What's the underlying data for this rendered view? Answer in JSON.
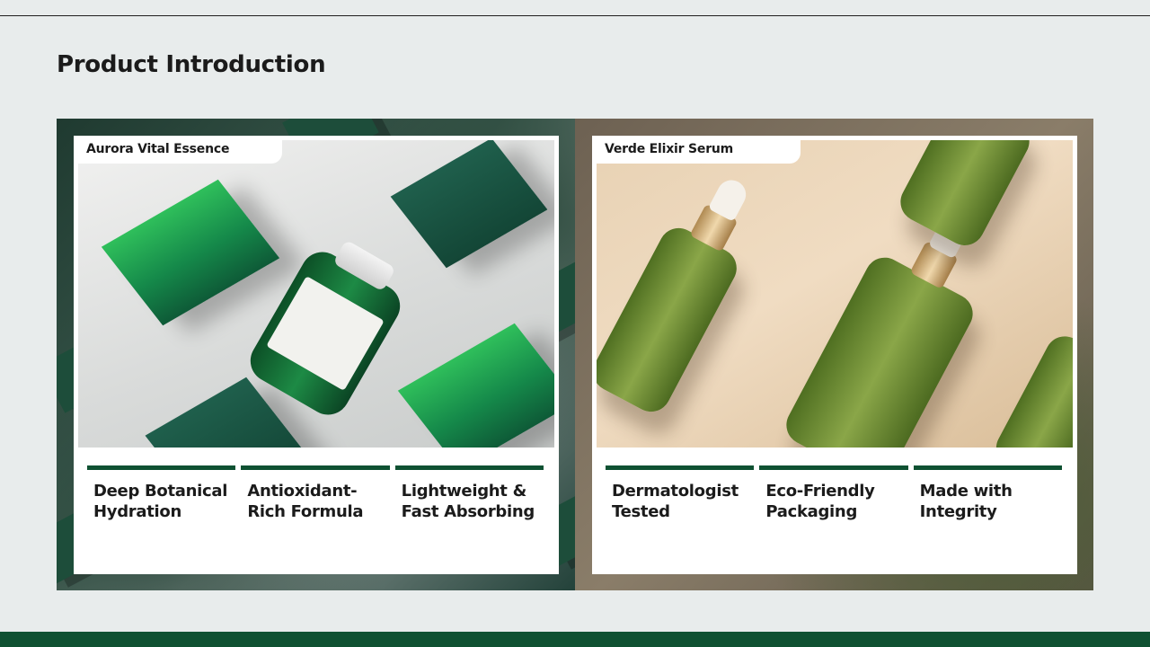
{
  "page": {
    "title": "Product Introduction"
  },
  "colors": {
    "accent": "#0f5132",
    "background": "#e8ecec",
    "card": "#ffffff"
  },
  "products": [
    {
      "name": "Aurora Vital Essence",
      "features": [
        "Deep Botanical Hydration",
        "Antioxidant-Rich Formula",
        "Lightweight & Fast Absorbing"
      ]
    },
    {
      "name": "Verde Elixir Serum",
      "features": [
        "Dermatologist Tested",
        "Eco-Friendly Packaging",
        "Made with Integrity"
      ]
    }
  ]
}
